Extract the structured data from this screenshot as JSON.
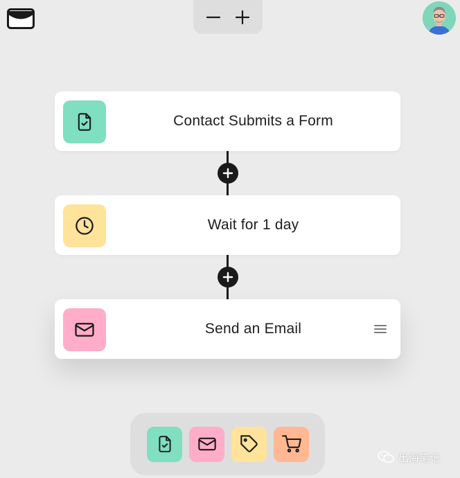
{
  "app": {
    "logo_icon": "envelope-logo-icon"
  },
  "zoom": {
    "zoom_out_icon": "minus-icon",
    "zoom_in_icon": "plus-icon"
  },
  "user": {
    "avatar_icon": "user-avatar"
  },
  "workflow": {
    "steps": [
      {
        "label": "Contact Submits a Form",
        "icon": "form-check-icon",
        "color": "#7fdfc0"
      },
      {
        "label": "Wait for 1 day",
        "icon": "clock-icon",
        "color": "#ffe39a"
      },
      {
        "label": "Send an Email",
        "icon": "mail-icon",
        "color": "#ffadc9"
      }
    ],
    "add_step_icon": "plus-icon",
    "drag_handle_icon": "menu-lines-icon"
  },
  "palette": {
    "items": [
      {
        "icon": "form-check-icon",
        "color": "#7fdfc0"
      },
      {
        "icon": "mail-icon",
        "color": "#ffadc9"
      },
      {
        "icon": "tag-icon",
        "color": "#ffe39a"
      },
      {
        "icon": "cart-icon",
        "color": "#ffb892"
      }
    ]
  },
  "watermark": {
    "text": "出海笔记"
  }
}
